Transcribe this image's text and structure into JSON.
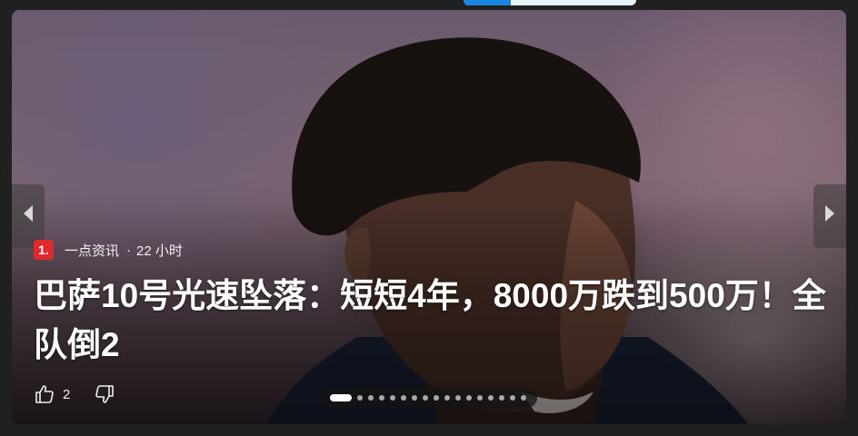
{
  "card": {
    "source_logo_text": "1.",
    "source_name": "一点资讯",
    "separator": "·",
    "time_ago": "22 小时",
    "headline": "巴萨10号光速坠落：短短4年，8000万跌到500万！全队倒2",
    "like_count": "2",
    "icons": {
      "prev": "chevron-left-icon",
      "next": "chevron-right-icon",
      "like": "thumbs-up-icon",
      "dislike": "thumbs-down-icon"
    },
    "pager": {
      "total": 17,
      "active_index": 0
    },
    "colors": {
      "source_logo": "#e0292f",
      "accent": "#1b86e0",
      "page_background": "#202020"
    }
  }
}
